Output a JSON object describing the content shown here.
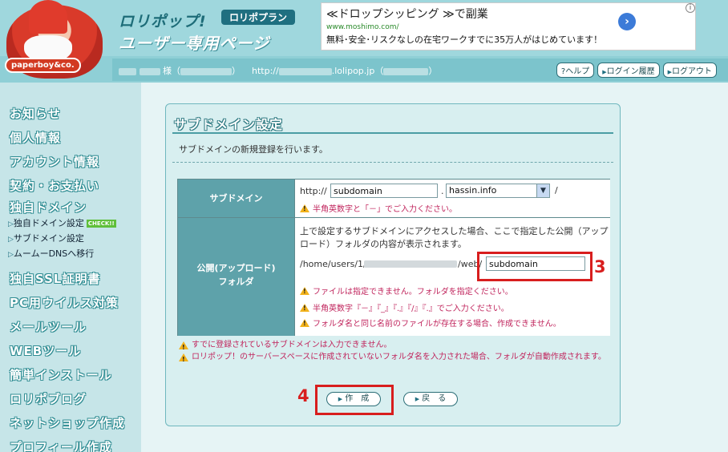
{
  "header": {
    "brand_main": "ロリポップ!",
    "brand_plan": "ロリポプラン",
    "brand_sub": "ユーザー専用ページ",
    "mascot_badge": "paperboy&co.",
    "user_suffix": "様（",
    "user_close": "）",
    "domain_prefix": "http://",
    "domain_suffix": ".lolipop.jp（",
    "domain_close": "）",
    "buttons": [
      "?ヘルプ",
      "ログイン履歴",
      "ログアウト"
    ]
  },
  "ad": {
    "title": "≪ドロップシッピング ≫で副業",
    "url": "www.moshimo.com/",
    "description": "無料･安全･リスクなしの在宅ワークすでに35万人がはじめています！",
    "info": "i"
  },
  "sidebar": {
    "items": [
      {
        "label": "お知らせ"
      },
      {
        "label": "個人情報"
      },
      {
        "label": "アカウント情報"
      },
      {
        "label": "契約・お支払い"
      },
      {
        "label": "独自ドメイン"
      }
    ],
    "subitems": [
      {
        "label": "独自ドメイン設定",
        "badge": "CHECK!!"
      },
      {
        "label": "サブドメイン設定"
      },
      {
        "label": "ムームーDNSへ移行"
      }
    ],
    "items2": [
      {
        "label": "独自SSL証明書"
      },
      {
        "label": "PC用ウイルス対策"
      },
      {
        "label": "メールツール"
      },
      {
        "label": "WEBツール"
      },
      {
        "label": "簡単インストール"
      },
      {
        "label": "ロリポブログ"
      },
      {
        "label": "ネットショップ作成"
      },
      {
        "label": "プロフィール作成"
      }
    ]
  },
  "panel": {
    "title": "サブドメイン設定",
    "description": "サブドメインの新規登録を行います。",
    "subdomain_label": "サブドメイン",
    "http_prefix": "http://",
    "subdomain_value": "subdomain",
    "dot": ".",
    "domain_selected": "hassin.info",
    "slash": "/",
    "subdomain_warning": "半角英数字と「－」でご入力ください。",
    "folder_label_1": "公開(アップロード)",
    "folder_label_2": "フォルダ",
    "folder_info_1": "上で設定するサブドメインにアクセスした場合、ここで指定した公開（アップ",
    "folder_info_2": "ロード）フォルダの内容が表示されます。",
    "path_prefix": "/home/users/1/",
    "path_web": "/web/",
    "folder_value": "subdomain",
    "folder_warnings": [
      "ファイルは指定できません。フォルダを指定ください。",
      "半角英数字『－』『_』『.』『/』『.』でご入力ください。",
      "フォルダ名と同じ名前のファイルが存在する場合、作成できません。"
    ],
    "notes": [
      "すでに登録されているサブドメインは入力できません。",
      "ロリポップ！のサーバースペースに作成されていないフォルダ名を入力された場合、フォルダが自動作成されます。"
    ],
    "create_button": "作　成",
    "back_button": "戻　る"
  },
  "annotations": {
    "step3": "3",
    "step4": "4"
  }
}
